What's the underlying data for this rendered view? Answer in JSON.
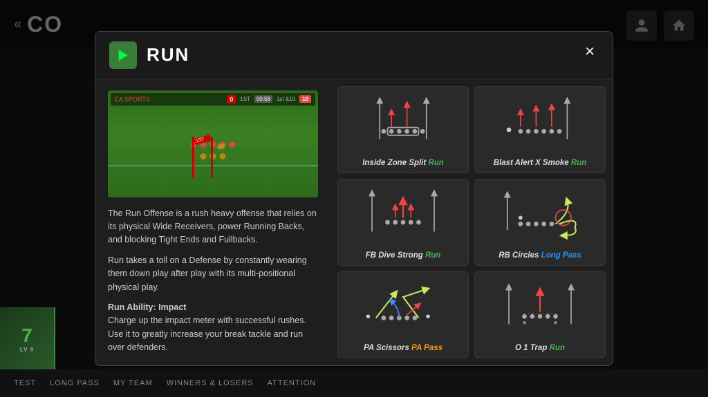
{
  "app": {
    "title": "CO",
    "close_label": "×"
  },
  "modal": {
    "title": "RUN",
    "close_label": "×",
    "description": [
      "The Run Offense is a rush heavy offense that relies on its physical Wide Receivers, power Running Backs, and blocking Tight Ends and Fullbacks.",
      "Run takes a toll on a Defense by constantly wearing them down play after play with its multi-positional physical play.",
      "Run Ability: Impact\nCharge up the impact meter with successful rushes. Use it to greatly increase your break tackle and run over defenders."
    ]
  },
  "plays": [
    {
      "name": "Inside Zone Split",
      "type": "Run",
      "type_class": "play-type-run",
      "diagram_type": "inside_zone_split"
    },
    {
      "name": "Blast Alert X Smoke",
      "type": "Run",
      "type_class": "play-type-run",
      "diagram_type": "blast_alert"
    },
    {
      "name": "FB Dive Strong",
      "type": "Run",
      "type_class": "play-type-run",
      "diagram_type": "fb_dive"
    },
    {
      "name": "RB Circles",
      "type": "Long Pass",
      "type_class": "play-type-longpass",
      "diagram_type": "rb_circles"
    },
    {
      "name": "PA Scissors",
      "type": "PA Pass",
      "type_class": "play-type-papass",
      "diagram_type": "pa_scissors"
    },
    {
      "name": "O 1 Trap",
      "type": "Run",
      "type_class": "play-type-run",
      "diagram_type": "o1_trap"
    }
  ],
  "bottom_nav": [
    {
      "label": "TEST"
    },
    {
      "label": "LONG PASS"
    },
    {
      "label": "MY TEAM"
    },
    {
      "label": "WINNERS & LOSERS"
    },
    {
      "label": "ATTENTION"
    }
  ]
}
